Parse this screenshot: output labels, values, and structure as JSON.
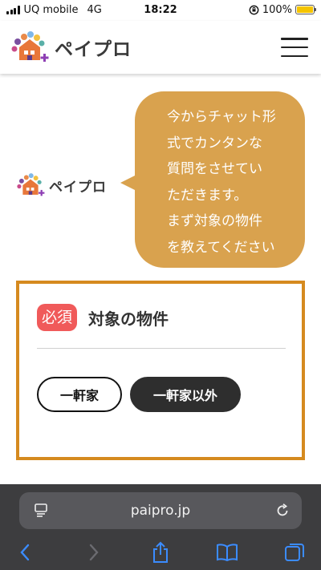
{
  "status_bar": {
    "carrier": "UQ mobile",
    "network": "4G",
    "time": "18:22",
    "battery": "100%",
    "battery_level": 1.0
  },
  "header": {
    "logo_text": "ペイプロ",
    "menu_icon": "hamburger-menu-icon"
  },
  "chat": {
    "logo_text": "ペイプロ",
    "bubble_lines": [
      "今からチャット形",
      "式でカンタンな",
      "質問をさせてい",
      "ただきます。",
      "まず対象の物件",
      "を教えてください"
    ]
  },
  "question": {
    "badge": "必須",
    "title": "対象の物件",
    "options": [
      "一軒家",
      "一軒家以外"
    ]
  },
  "browser": {
    "url": "paipro.jp"
  },
  "colors": {
    "bubble": "#d9a24e",
    "card_border": "#d58a1f",
    "badge": "#f05a5a",
    "browser_bg": "#3d3d3f",
    "toolbar_icon": "#3b8cff"
  }
}
